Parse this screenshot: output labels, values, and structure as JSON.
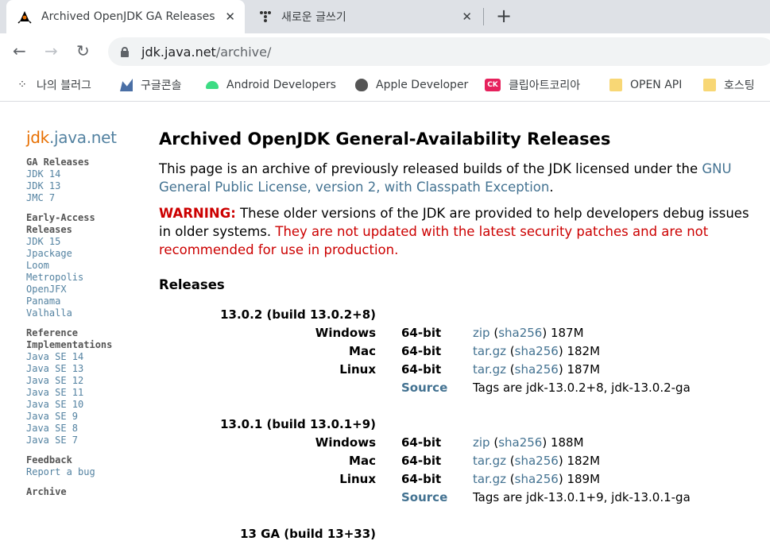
{
  "browser": {
    "tabs": [
      {
        "title": "Archived OpenJDK GA Releases",
        "active": true
      },
      {
        "title": "새로운 글쓰기",
        "active": false
      }
    ],
    "url_host": "jdk.java.net",
    "url_path": "/archive/",
    "bookmarks": [
      {
        "label": "나의 블러그",
        "icon": "tistory-icon"
      },
      {
        "label": "구글콘솔",
        "icon": "google-console-icon"
      },
      {
        "label": "Android Developers",
        "icon": "android-icon"
      },
      {
        "label": "Apple Developer",
        "icon": "apple-icon"
      },
      {
        "label": "클립아트코리아",
        "icon": "ck-icon"
      },
      {
        "label": "OPEN API",
        "icon": "folder-icon"
      },
      {
        "label": "호스팅",
        "icon": "folder-icon"
      }
    ],
    "glyphs": {
      "close": "✕",
      "new_tab": "+",
      "back": "←",
      "forward": "→",
      "reload": "↻",
      "tistory": "⁘",
      "ck": "CK"
    }
  },
  "sidebar": {
    "logo_jdk": "jdk",
    "logo_rest": ".java.net",
    "groups": [
      {
        "title": "GA Releases",
        "links": [
          "JDK 14",
          "JDK 13",
          "JMC 7"
        ]
      },
      {
        "title": "Early-Access Releases",
        "links": [
          "JDK 15",
          "Jpackage",
          "Loom",
          "Metropolis",
          "OpenJFX",
          "Panama",
          "Valhalla"
        ]
      },
      {
        "title": "Reference Implementations",
        "links": [
          "Java SE 14",
          "Java SE 13",
          "Java SE 12",
          "Java SE 11",
          "Java SE 10",
          "Java SE 9",
          "Java SE 8",
          "Java SE 7"
        ]
      },
      {
        "title": "Feedback",
        "links": [
          "Report a bug"
        ]
      },
      {
        "title": "Archive",
        "links": []
      }
    ]
  },
  "main": {
    "title": "Archived OpenJDK General-Availability Releases",
    "intro_text": "This page is an archive of previously released builds of the JDK licensed under the ",
    "intro_link": "GNU General Public License, version 2, with Classpath Exception",
    "intro_end": ".",
    "warning_label": "WARNING:",
    "warning_text": " These older versions of the JDK are provided to help developers debug issues in older systems. ",
    "warning_red": "They are not updated with the latest security patches and are not recommended for use in production.",
    "releases_heading": "Releases",
    "releases": [
      {
        "title": "13.0.2 (build 13.0.2+8)",
        "rows": [
          {
            "os": "Windows",
            "arch": "64-bit",
            "archive": "zip",
            "sha": "sha256",
            "size": "187M"
          },
          {
            "os": "Mac",
            "arch": "64-bit",
            "archive": "tar.gz",
            "sha": "sha256",
            "size": "182M"
          },
          {
            "os": "Linux",
            "arch": "64-bit",
            "archive": "tar.gz",
            "sha": "sha256",
            "size": "187M"
          }
        ],
        "source_label": "Source",
        "tags": "Tags are jdk-13.0.2+8, jdk-13.0.2-ga"
      },
      {
        "title": "13.0.1 (build 13.0.1+9)",
        "rows": [
          {
            "os": "Windows",
            "arch": "64-bit",
            "archive": "zip",
            "sha": "sha256",
            "size": "188M"
          },
          {
            "os": "Mac",
            "arch": "64-bit",
            "archive": "tar.gz",
            "sha": "sha256",
            "size": "182M"
          },
          {
            "os": "Linux",
            "arch": "64-bit",
            "archive": "tar.gz",
            "sha": "sha256",
            "size": "189M"
          }
        ],
        "source_label": "Source",
        "tags": "Tags are jdk-13.0.1+9, jdk-13.0.1-ga"
      },
      {
        "title": "13 GA (build 13+33)",
        "rows": [],
        "source_label": "",
        "tags": ""
      }
    ]
  }
}
